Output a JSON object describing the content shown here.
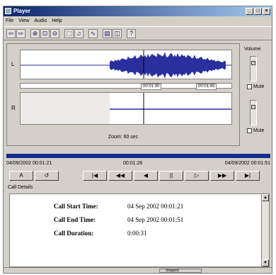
{
  "window": {
    "title": "Player",
    "controls": [
      "_",
      "□",
      "×"
    ]
  },
  "menu": [
    "File",
    "View",
    "Audio",
    "Help"
  ],
  "toolbar": {
    "icons": [
      "back-arrow-icon",
      "forward-arrow-icon",
      "zoom-in-icon",
      "zoom-fit-icon",
      "zoom-out-icon",
      "select-icon",
      "play-selection-icon",
      "waveform-icon",
      "export-icon",
      "split-view-icon",
      "help-icon"
    ]
  },
  "channels": {
    "left_label": "L",
    "right_label": "R"
  },
  "ruler": {
    "marker1": "00:01:30",
    "marker2": "00:01:45"
  },
  "zoom_label": "Zoom: 60 sec",
  "volume": {
    "label": "Volume",
    "mute_label": "Mute"
  },
  "playback": {
    "progress": 1.0
  },
  "timeline": {
    "start": "04/09/2002 00:01:21",
    "position": "00:01:26",
    "end": "04/09/2002 00:01:51"
  },
  "controls": {
    "ab_label": "A",
    "loop_label": "↺",
    "first": "|◀",
    "rewind": "◀◀",
    "back": "◀",
    "pause": "||",
    "play": "▷",
    "ffwd": "▶▶",
    "last": "▶|"
  },
  "call_details_label": "Call Details",
  "call_details": [
    {
      "key": "Call Start Time:",
      "value": "04 Sep 2002 00:01:21"
    },
    {
      "key": "Call End Time:",
      "value": "04 Sep 2002 00:01:51"
    },
    {
      "key": "Call Duration:",
      "value": "0:00:31"
    }
  ],
  "status": {
    "text": "Stopped"
  },
  "colors": {
    "waveform": "#2a2f9e",
    "progress": "#0f2d8a",
    "title_bg": "#0a246a"
  }
}
